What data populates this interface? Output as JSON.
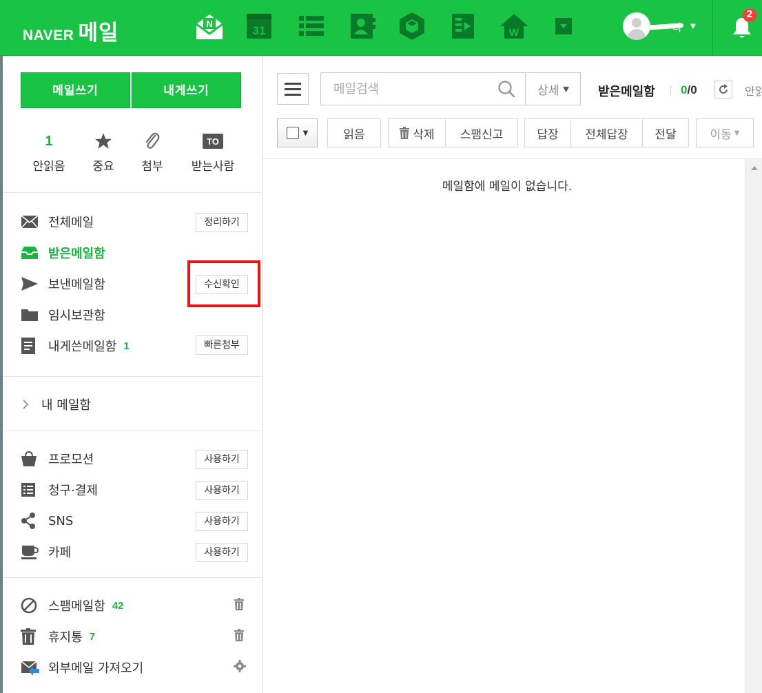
{
  "header": {
    "logo_brand": "NAVER",
    "logo_service": "메일",
    "apps": [
      "mail-app-icon",
      "calendar-app-icon",
      "todo-app-icon",
      "contacts-app-icon",
      "box-app-icon",
      "memo-app-icon",
      "office-app-icon",
      "more-apps-icon"
    ],
    "calendar_day": "31",
    "profile_name_suffix": "다",
    "notification_count": "2",
    "colors": {
      "green": "#19c343",
      "badge": "#ff3d3d"
    }
  },
  "sidebar": {
    "compose_label": "메일쓰기",
    "self_compose_label": "내게쓰기",
    "quick": [
      {
        "label": "안읽음",
        "value": "1",
        "icon": "unread-count"
      },
      {
        "label": "중요",
        "icon": "star-icon"
      },
      {
        "label": "첨부",
        "icon": "paperclip-icon"
      },
      {
        "label": "받는사람",
        "icon": "to-icon",
        "icon_text": "TO"
      }
    ],
    "folders": {
      "all": {
        "label": "전체메일",
        "action": "정리하기"
      },
      "inbox": {
        "label": "받은메일함"
      },
      "sent": {
        "label": "보낸메일함",
        "action": "수신확인"
      },
      "drafts": {
        "label": "임시보관함"
      },
      "self": {
        "label": "내게쓴메일함",
        "count": "1",
        "action": "빠른첨부"
      }
    },
    "my_mailbox_label": "내 메일함",
    "smart": {
      "promotion": {
        "label": "프로모션",
        "action": "사용하기"
      },
      "billing": {
        "label": "청구·결제",
        "action": "사용하기"
      },
      "sns": {
        "label": "SNS",
        "action": "사용하기"
      },
      "cafe": {
        "label": "카페",
        "action": "사용하기"
      }
    },
    "bottom": {
      "spam": {
        "label": "스팸메일함",
        "count": "42"
      },
      "trash": {
        "label": "휴지통",
        "count": "7"
      },
      "external": {
        "label": "외부메일 가져오기"
      }
    }
  },
  "main": {
    "search_placeholder": "메일검색",
    "detail_label": "상세",
    "mailbox_title": "받은메일함",
    "unread_count": "0",
    "count_sep": "/",
    "total_count": "0",
    "unread_link": "안읽",
    "toolbar": {
      "read": "읽음",
      "delete": "삭제",
      "spam": "스팸신고",
      "reply": "답장",
      "reply_all": "전체답장",
      "forward": "전달",
      "move": "이동"
    },
    "empty_message": "메일함에 메일이 없습니다."
  }
}
